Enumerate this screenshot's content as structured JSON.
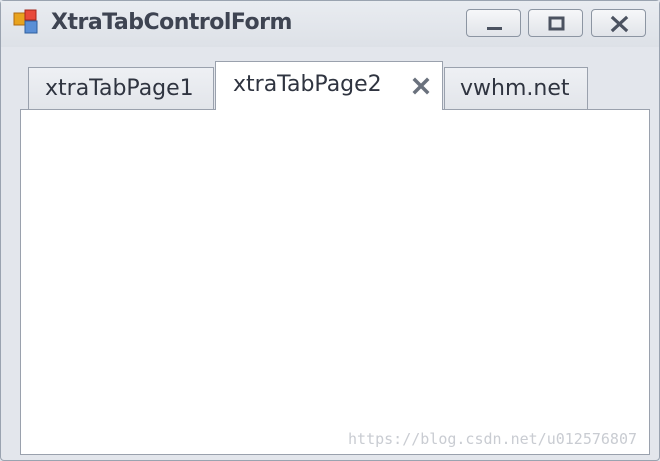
{
  "window": {
    "title": "XtraTabControlForm",
    "icon": "form-app-icon",
    "controls": [
      "minimize-icon",
      "maximize-icon",
      "close-icon"
    ]
  },
  "tabs": [
    {
      "label": "xtraTabPage1",
      "selected": false
    },
    {
      "label": "xtraTabPage2",
      "selected": true,
      "close_icon": "close-x-icon"
    },
    {
      "label": "vwhm.net",
      "selected": false
    }
  ],
  "watermark": "https://blog.csdn.net/u012576807",
  "colors": {
    "frame": "#e3e6ec",
    "page_background": "#ffffff",
    "tab_border": "#9aa1ad",
    "tab_text": "#2f3440"
  }
}
